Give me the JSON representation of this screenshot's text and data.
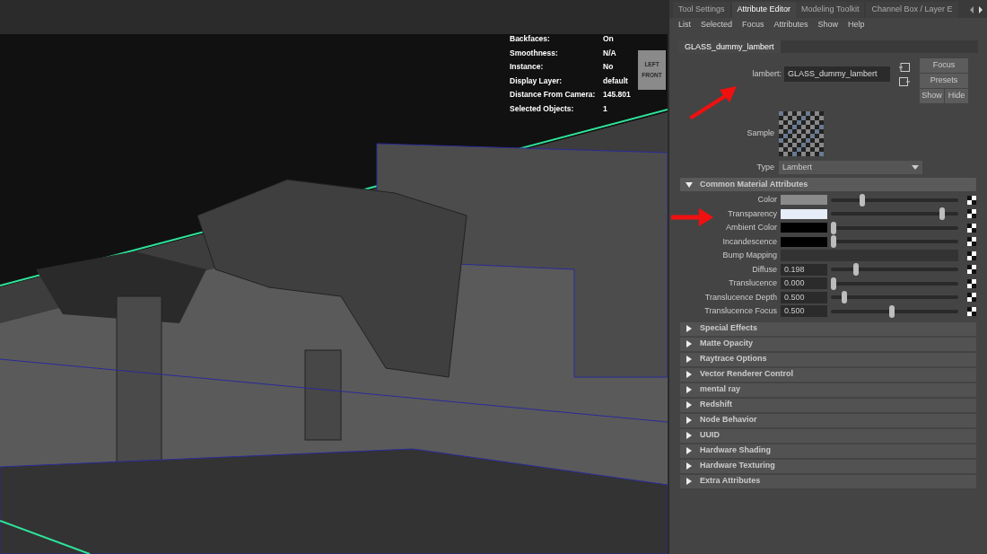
{
  "viewport": {
    "hud": [
      {
        "label": "Backfaces:",
        "value": "On"
      },
      {
        "label": "Smoothness:",
        "value": "N/A"
      },
      {
        "label": "Instance:",
        "value": "No"
      },
      {
        "label": "Display Layer:",
        "value": "default"
      },
      {
        "label": "Distance From Camera:",
        "value": "145.801"
      },
      {
        "label": "Selected Objects:",
        "value": "1"
      }
    ],
    "view_cube": {
      "left": "LEFT",
      "front": "FRONT"
    }
  },
  "panel": {
    "tabs": [
      {
        "label": "Tool Settings",
        "selected": false
      },
      {
        "label": "Attribute Editor",
        "selected": true
      },
      {
        "label": "Modeling Toolkit",
        "selected": false
      },
      {
        "label": "Channel Box / Layer E",
        "selected": false
      }
    ],
    "menu": [
      "List",
      "Selected",
      "Focus",
      "Attributes",
      "Show",
      "Help"
    ],
    "node_tab": "GLASS_dummy_lambert",
    "node_label": "lambert:",
    "node_name": "GLASS_dummy_lambert",
    "buttons": {
      "focus": "Focus",
      "presets": "Presets",
      "show": "Show",
      "hide": "Hide"
    },
    "sample_label": "Sample",
    "type_label": "Type",
    "type_value": "Lambert",
    "sections": [
      {
        "title": "Common Material Attributes",
        "expanded": true,
        "attributes": [
          {
            "kind": "color",
            "label": "Color",
            "color": "#8a8a8a",
            "level": 0.24
          },
          {
            "kind": "color",
            "label": "Transparency",
            "color": "#e6ecf8",
            "level": 0.91
          },
          {
            "kind": "color",
            "label": "Ambient Color",
            "color": "#000000",
            "level": 0
          },
          {
            "kind": "color",
            "label": "Incandescence",
            "color": "#000000",
            "level": 0
          },
          {
            "kind": "slot",
            "label": "Bump Mapping"
          },
          {
            "kind": "number",
            "label": "Diffuse",
            "value": "0.198",
            "level": 0.19
          },
          {
            "kind": "number",
            "label": "Translucence",
            "value": "0.000",
            "level": 0
          },
          {
            "kind": "number",
            "label": "Translucence Depth",
            "value": "0.500",
            "level": 0.09
          },
          {
            "kind": "number",
            "label": "Translucence Focus",
            "value": "0.500",
            "level": 0.49
          }
        ]
      },
      {
        "title": "Special Effects",
        "expanded": false
      },
      {
        "title": "Matte Opacity",
        "expanded": false
      },
      {
        "title": "Raytrace Options",
        "expanded": false
      },
      {
        "title": "Vector Renderer Control",
        "expanded": false
      },
      {
        "title": "mental ray",
        "expanded": false
      },
      {
        "title": "Redshift",
        "expanded": false
      },
      {
        "title": "Node Behavior",
        "expanded": false
      },
      {
        "title": "UUID",
        "expanded": false
      },
      {
        "title": "Hardware Shading",
        "expanded": false
      },
      {
        "title": "Hardware Texturing",
        "expanded": false
      },
      {
        "title": "Extra Attributes",
        "expanded": false
      }
    ]
  }
}
